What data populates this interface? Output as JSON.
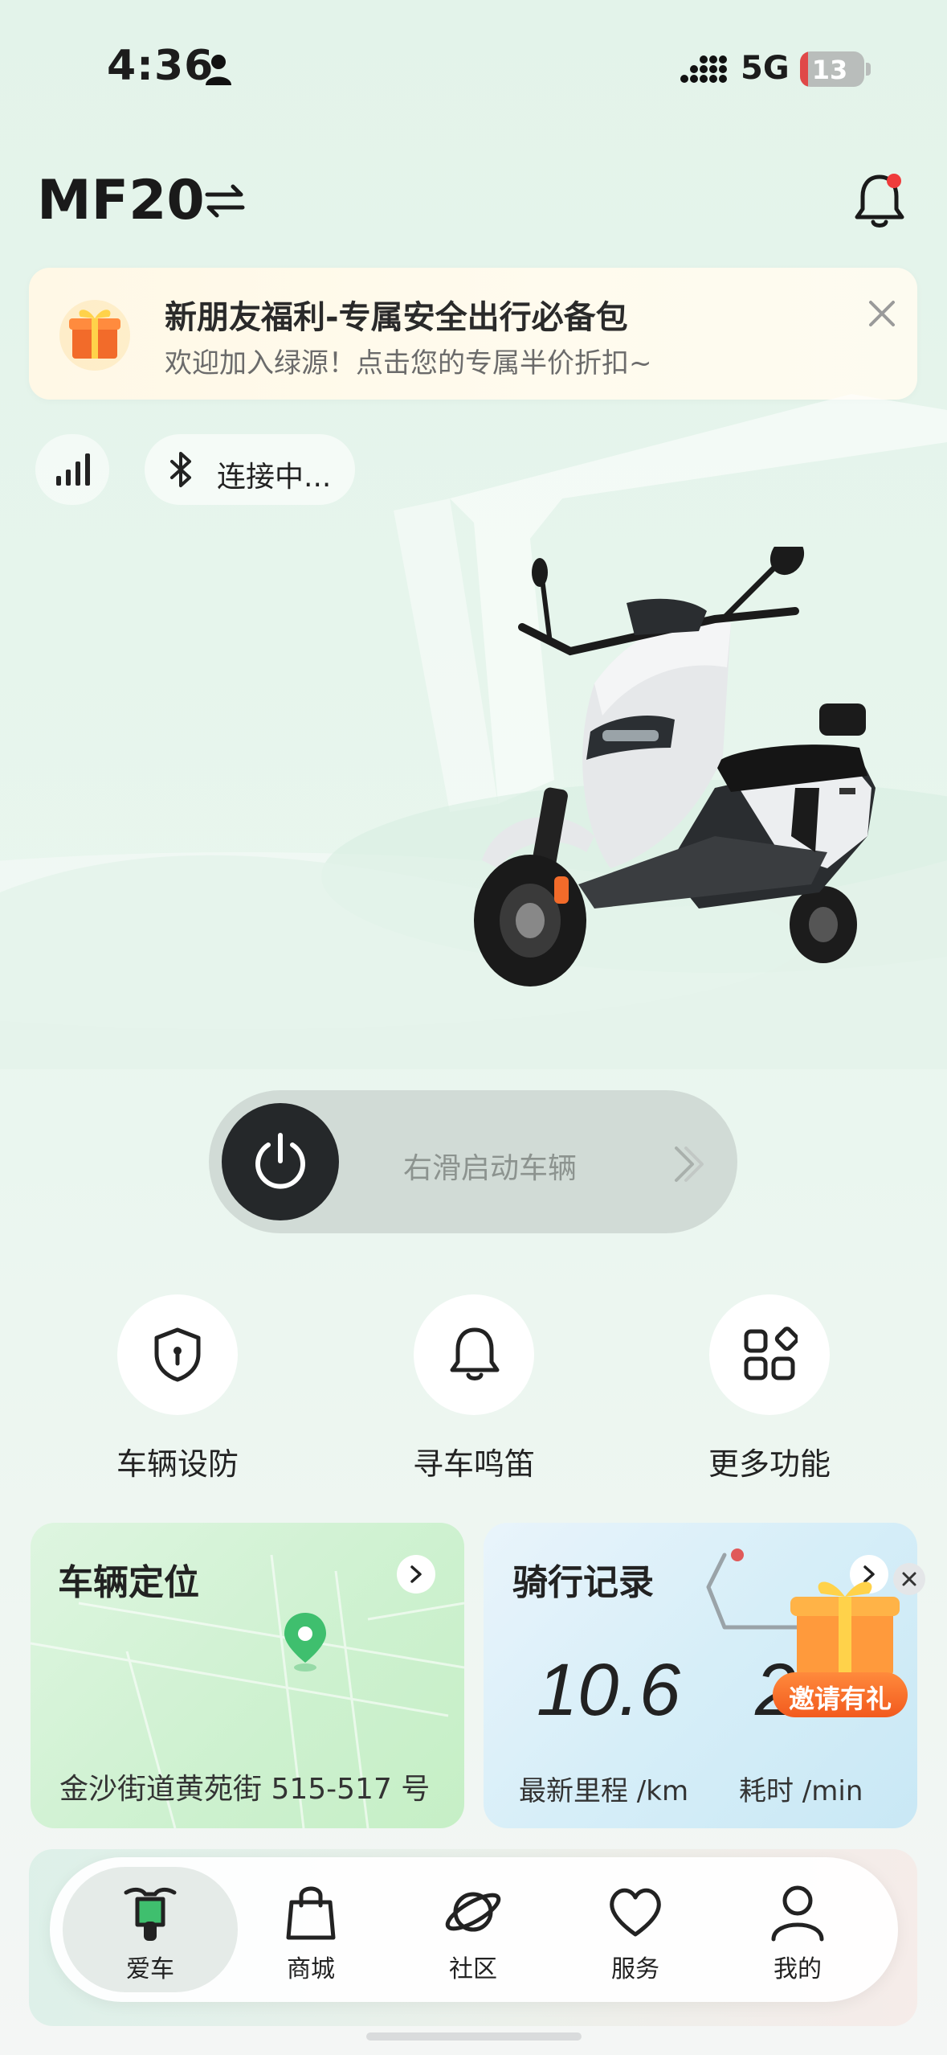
{
  "status_bar": {
    "time": "4:36",
    "network": "5G",
    "battery": "13",
    "battery_level": 0.13
  },
  "header": {
    "vehicle_name": "MF20"
  },
  "promo": {
    "title": "新朋友福利-专属安全出行必备包",
    "subtitle": "欢迎加入绿源！点击您的专属半价折扣~"
  },
  "connection": {
    "bluetooth_label": "连接中..."
  },
  "start_slider": {
    "label": "右滑启动车辆"
  },
  "quick_actions": [
    {
      "label": "车辆设防",
      "icon": "shield-lock-icon"
    },
    {
      "label": "寻车鸣笛",
      "icon": "bell-icon"
    },
    {
      "label": "更多功能",
      "icon": "grid-apps-icon"
    }
  ],
  "location_card": {
    "title": "车辆定位",
    "address": "金沙街道黄苑街 515-517 号"
  },
  "ride_card": {
    "title": "骑行记录",
    "distance_value": "10.6",
    "duration_value": "2",
    "distance_label": "最新里程 /km",
    "duration_label": "耗时 /min",
    "invite_label": "邀请有礼"
  },
  "bottom_nav": [
    {
      "label": "爱车",
      "icon": "scooter-icon",
      "active": true
    },
    {
      "label": "商城",
      "icon": "shopping-bag-icon",
      "active": false
    },
    {
      "label": "社区",
      "icon": "planet-icon",
      "active": false
    },
    {
      "label": "服务",
      "icon": "heart-icon",
      "active": false
    },
    {
      "label": "我的",
      "icon": "person-icon",
      "active": false
    }
  ],
  "colors": {
    "accent_green": "#3fbf6e",
    "dark": "#25282a",
    "notification_red": "#ef3b3b",
    "invite_orange": "#f25a1e"
  }
}
